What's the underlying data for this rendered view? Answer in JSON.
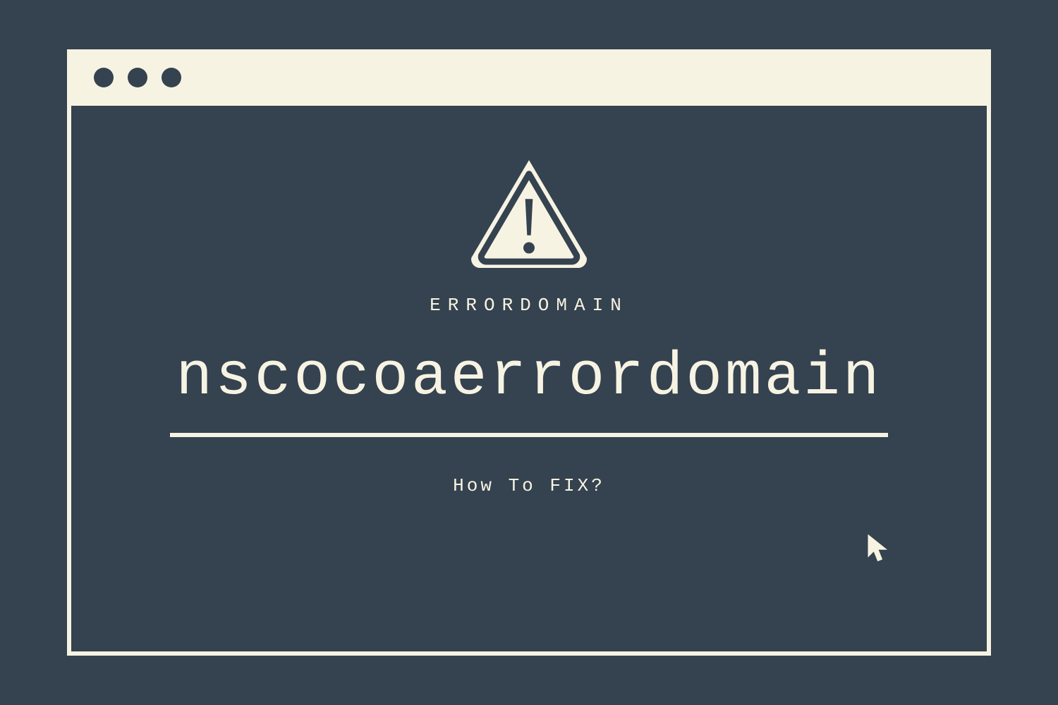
{
  "colors": {
    "background": "#35424f",
    "cream": "#f7f3e3"
  },
  "content": {
    "label": "ERRORDOMAIN",
    "title": "nscocoaerrordomain",
    "subtitle": "How To FIX?"
  },
  "icons": {
    "warning": "warning-triangle-icon",
    "cursor": "cursor-arrow-icon"
  }
}
